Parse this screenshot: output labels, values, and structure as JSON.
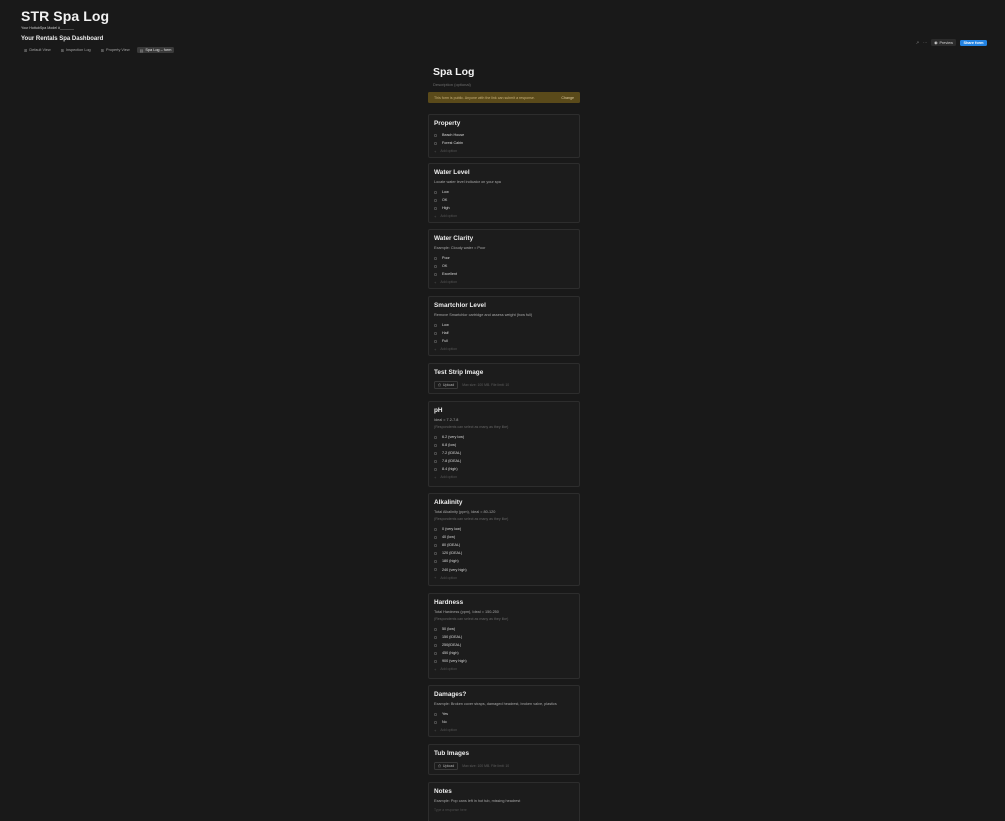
{
  "header": {
    "title": "STR Spa Log",
    "subtitle": "Your HottubSpa Model #_______",
    "dashboard_title": "Your Rentals Spa Dashboard",
    "tabs": [
      {
        "label": "Default View",
        "icon": "table-icon",
        "active": false
      },
      {
        "label": "Inspection Log",
        "icon": "table-icon",
        "active": false
      },
      {
        "label": "Property View",
        "icon": "table-icon",
        "active": false
      },
      {
        "label": "Spa Log – form",
        "icon": "form-icon",
        "active": true
      }
    ]
  },
  "toolbar": {
    "preview_label": "Preview",
    "share_label": "Share form"
  },
  "form": {
    "title": "Spa Log",
    "description_placeholder": "Description (optional)",
    "banner_text": "This form is public. Anyone with the link can submit a response.",
    "banner_action": "Change",
    "add_option_label": "Add option",
    "upload_label": "Upload",
    "upload_hint": "Max size: 100 MB. File limit: 10",
    "multi_note": "(Respondents can select as many as they like)",
    "questions": [
      {
        "title": "Property",
        "description": "",
        "options": [
          "Beach House",
          "Forest Cabin"
        ]
      },
      {
        "title": "Water Level",
        "description": "Locate water level indicator on your spa",
        "options": [
          "Low",
          "OK",
          "High"
        ]
      },
      {
        "title": "Water Clarity",
        "description": "Example: Cloudy water = Poor",
        "options": [
          "Poor",
          "OK",
          "Excellent"
        ]
      },
      {
        "title": "Smartchlor Level",
        "description": "Remove Smartchlor cartridge and assess weight (how full)",
        "options": [
          "Low",
          "Half",
          "Full"
        ]
      },
      {
        "title": "Test Strip Image",
        "type": "upload"
      },
      {
        "title": "pH",
        "description": "Ideal = 7.2-7.8",
        "multi": true,
        "options": [
          "6.2 (very low)",
          "6.8 (low)",
          "7.2 (IDEAL)",
          "7.8 (IDEAL)",
          "8.4 (high)"
        ]
      },
      {
        "title": "Alkalinity",
        "description": "Total Alkalinity (ppm), Ideal = 80-120",
        "multi": true,
        "options": [
          "0 (very low)",
          "40 (low)",
          "80 (IDEAL)",
          "120 (IDEAL)",
          "180 (high)",
          "240 (very high)"
        ]
      },
      {
        "title": "Hardness",
        "description": "Total Hardness (ppm), Ideal = 150-250",
        "multi": true,
        "options": [
          "50 (low)",
          "150 (IDEAL)",
          "250(IDEAL)",
          "450 (high)",
          "900 (very high)"
        ]
      },
      {
        "title": "Damages?",
        "description": "Example: Broken cover straps, damaged headrest, broken valve, plastics",
        "options": [
          "Yes",
          "No"
        ]
      },
      {
        "title": "Tub Images",
        "type": "upload"
      },
      {
        "title": "Notes",
        "description": "Example: Pop cans left in hot tub, missing headrest",
        "type": "text",
        "placeholder": "Type a response here"
      }
    ]
  }
}
